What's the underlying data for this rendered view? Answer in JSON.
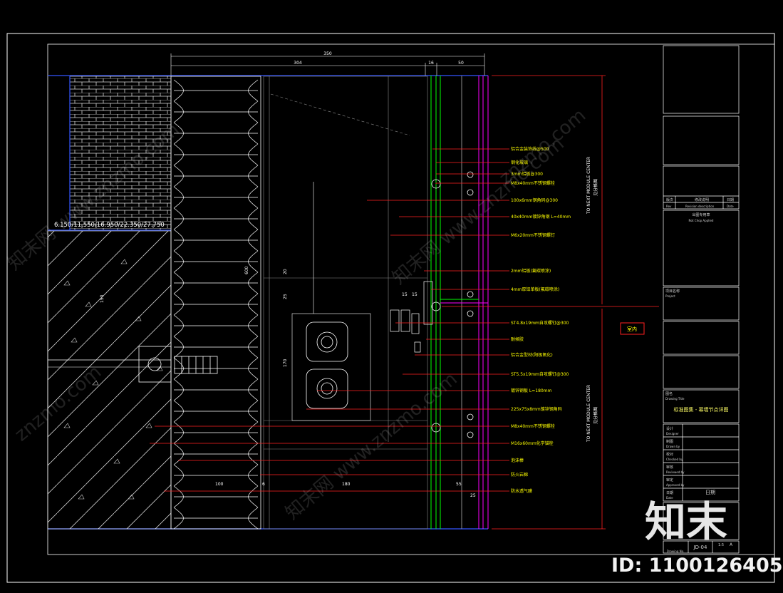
{
  "drawing": {
    "dims_top": [
      "350",
      "304",
      "16",
      "50"
    ],
    "dims_left": [
      "600",
      "150",
      "20",
      "25",
      "170",
      "15",
      "15"
    ],
    "dims_bottom": [
      "100",
      "6",
      "180",
      "55",
      "25"
    ],
    "level_text": "6.150/11.550/16.950/22.350/27.750",
    "vertical_note_1": "TO NEXT MODULE CENTER",
    "vertical_note_1b": "见分格图",
    "vertical_note_2": "TO NEXT MODULE CENTER",
    "vertical_note_2b": "见分格图",
    "callout_box": "室内",
    "callouts": [
      "铝合金装饰线@500",
      "钢化玻璃",
      "3mm铝板@300",
      "M8x40mm不锈钢螺栓",
      "100x6mm钢角码@300",
      "40x40mm镀锌角钢 L=40mm",
      "M6x20mm不锈钢螺钉",
      "2mm铝板(氟碳喷涂)",
      "4mm厚铝单板(氟碳喷涂)",
      "ST4.8x19mm自攻螺钉@300",
      "耐候胶",
      "铝合金型材(阳极氧化)",
      "ST5.5x19mm自攻螺钉@300",
      "镀锌钢板 L=180mm",
      "225x75x8mm镀锌钢角码",
      "M8x40mm不锈钢螺栓",
      "M16x60mm化学锚栓",
      "泡沫棒",
      "防火岩棉",
      "防水透气膜"
    ]
  },
  "title_block": {
    "rev_label": "版次",
    "desc_label": "修改说明",
    "date_label": "日期",
    "rev_en": "Rev",
    "desc_en": "Revision description",
    "date_en": "Date",
    "stamp_cn": "出图专用章",
    "stamp_en": "Not Chop Applied",
    "project_cn": "项目名称",
    "project_en": "Project",
    "title_cn": "图名",
    "title_en": "Drawing Title",
    "drawing_title": "标准图集 - 幕墙节点详图",
    "designer_cn": "设计",
    "designer_en": "Designer",
    "drawer_cn": "制图",
    "drawer_en": "Drawn by",
    "checker_cn": "校对",
    "checker_en": "Checked by",
    "reviewer_cn": "审核",
    "reviewer_en": "Reviewed by",
    "approver_cn": "审定",
    "approver_en": "Approved by",
    "date_cn": "日期",
    "date2_en": "Date",
    "date_value": "日期",
    "dwg_no": "JD-04",
    "dwg_no_label": "Drawing No.",
    "scale": "1:5",
    "rev_value": "A"
  },
  "watermarks": [
    "知末网 www.znzmo.com",
    "znzmo.com",
    "知末网 www.znzmo.com",
    "知末网 www.znzmo.com",
    "znzmo.com"
  ],
  "brand": {
    "logo": "知末",
    "id_text": "ID: 1100126405"
  },
  "colors": {
    "frame": "#3355ff",
    "red": "#ff2020",
    "yellow": "#ffff00",
    "green": "#00ff00",
    "magenta": "#ff00ff",
    "white": "#ffffff",
    "gray": "#8a8a8a"
  }
}
